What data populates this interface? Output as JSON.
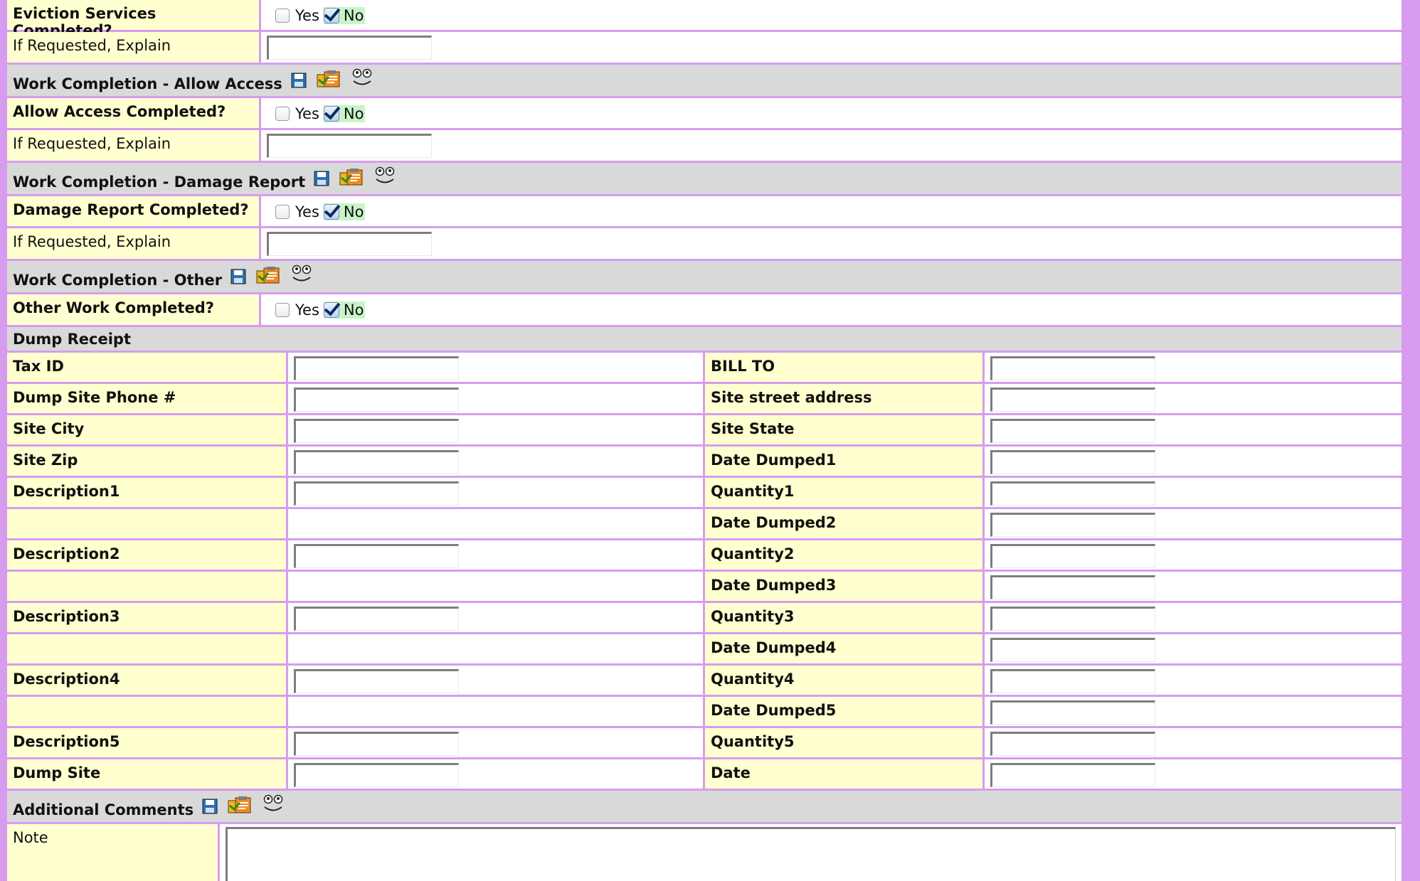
{
  "yes_label": "Yes",
  "no_label": "No",
  "sections": {
    "eviction": {
      "completed_label": "Eviction Services Completed?",
      "explain_label": "If Requested, Explain"
    },
    "allow_access": {
      "title": "Work Completion - Allow Access",
      "completed_label": "Allow Access Completed?",
      "explain_label": "If Requested, Explain"
    },
    "damage_report": {
      "title": "Work Completion - Damage Report",
      "completed_label": "Damage Report Completed?",
      "explain_label": "If Requested, Explain"
    },
    "other": {
      "title": "Work Completion - Other",
      "completed_label": "Other Work Completed?"
    },
    "dump_receipt": {
      "title": "Dump Receipt",
      "rows": [
        {
          "left": "Tax ID",
          "right": "BILL TO"
        },
        {
          "left": "Dump Site Phone #",
          "right": "Site street address"
        },
        {
          "left": "Site City",
          "right": "Site State"
        },
        {
          "left": "Site Zip",
          "right": "Date Dumped1"
        },
        {
          "left": "Description1",
          "right": "Quantity1"
        },
        {
          "left": "",
          "right": "Date Dumped2"
        },
        {
          "left": "Description2",
          "right": "Quantity2"
        },
        {
          "left": "",
          "right": "Date Dumped3"
        },
        {
          "left": "Description3",
          "right": "Quantity3"
        },
        {
          "left": "",
          "right": "Date Dumped4"
        },
        {
          "left": "Description4",
          "right": "Quantity4"
        },
        {
          "left": "",
          "right": "Date Dumped5"
        },
        {
          "left": "Description5",
          "right": "Quantity5"
        },
        {
          "left": "Dump Site",
          "right": "Date"
        }
      ]
    },
    "additional_comments": {
      "title": "Additional Comments",
      "note_label": "Note"
    }
  },
  "icons": {
    "save": "save-icon",
    "clipboard": "clipboard-icon",
    "face": "face-icon"
  },
  "colors": {
    "page_bg": "#d79cef",
    "label_bg": "#ffffd0",
    "section_bg": "#d9d9d9",
    "no_highlight": "#c9f4c9"
  }
}
